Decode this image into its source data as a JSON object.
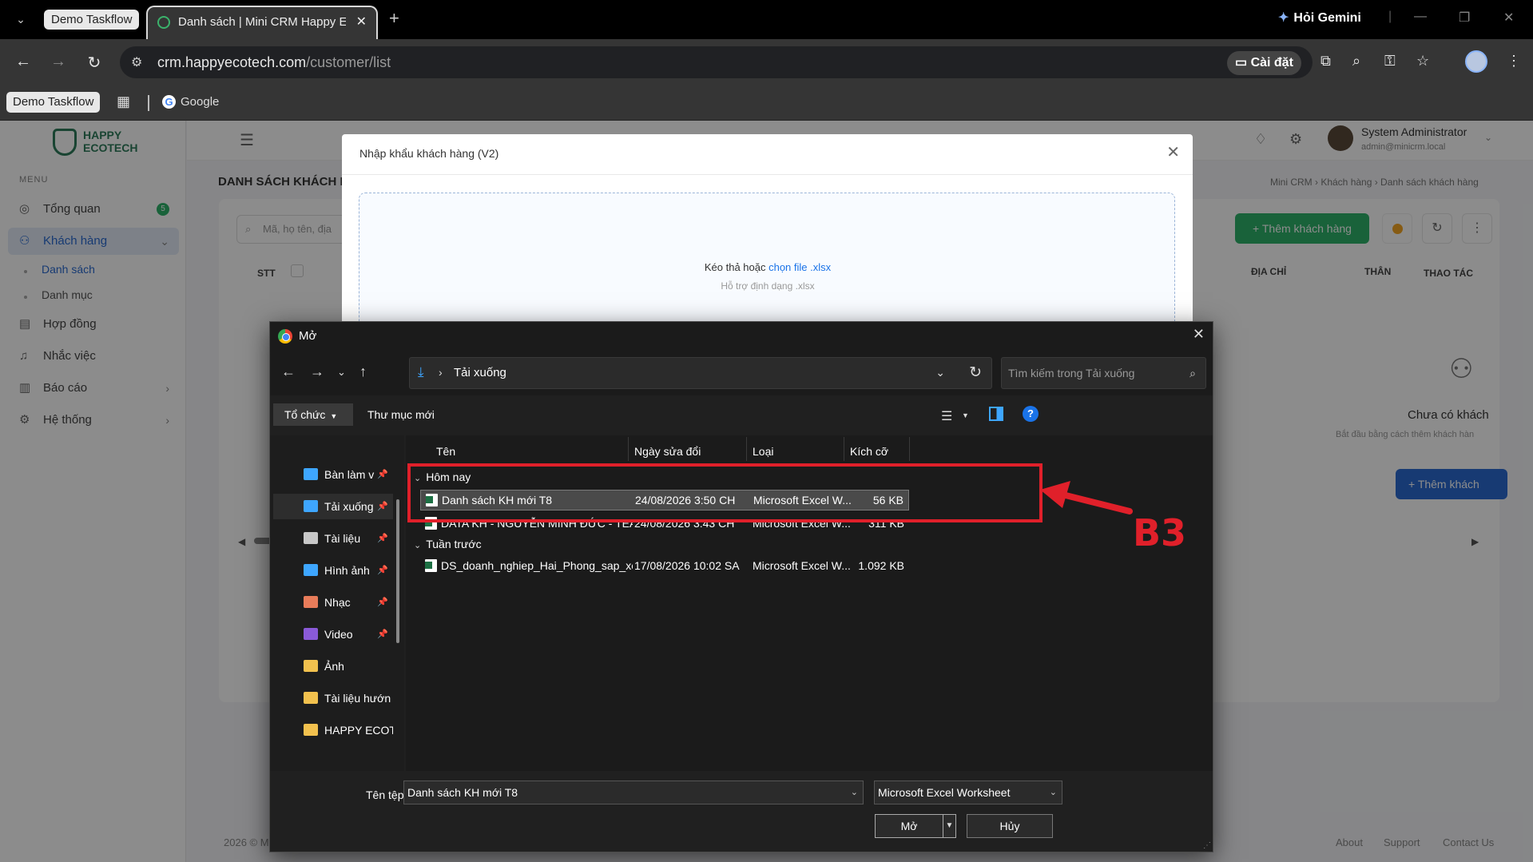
{
  "browser": {
    "tab_group_label": "Demo Taskflow",
    "active_tab_title": "Danh sách | Mini CRM Happy E",
    "gemini_label": "Hỏi Gemini",
    "url_host": "crm.happyecotech.com",
    "url_path": "/customer/list",
    "install_label": "Cài đặt",
    "bookmarks": {
      "group_label": "Demo Taskflow",
      "google_label": "Google"
    }
  },
  "app": {
    "logo_line1": "HAPPY",
    "logo_line2": "ECOTECH",
    "menu_caption": "MENU",
    "sidebar": {
      "items": [
        {
          "label": "Tổng quan",
          "badge": "5"
        },
        {
          "label": "Khách hàng"
        },
        {
          "label": "Hợp đồng"
        },
        {
          "label": "Nhắc việc"
        },
        {
          "label": "Báo cáo"
        },
        {
          "label": "Hệ thống"
        }
      ],
      "sub_items": [
        "Danh sách",
        "Danh mục"
      ]
    },
    "user": {
      "name": "System Administrator",
      "email": "admin@minicrm.local"
    },
    "page_title": "DANH SÁCH KHÁCH H",
    "breadcrumb": "Mini CRM  ›  Khách hàng  ›  Danh sách khách hàng",
    "search_placeholder": "Mã, họ tên, địa",
    "add_button": "+ Thêm khách hàng",
    "table_headers": [
      "STT",
      "ĐỊA CHỈ",
      "THÂN",
      "THAO TÁC"
    ],
    "empty_title": "Chưa có khách",
    "empty_sub": "Bắt đầu bằng cách thêm khách hàn",
    "empty_button": "+ Thêm khách",
    "footer_copy": "2026 © M",
    "footer_links": [
      "About",
      "Support",
      "Contact Us"
    ]
  },
  "import_modal": {
    "title": "Nhập khẩu khách hàng (V2)",
    "drop_text": "Kéo thả hoặc ",
    "drop_link": "chọn file .xlsx",
    "drop_sub": "Hỗ trợ định dạng .xlsx"
  },
  "file_dialog": {
    "title": "Mở",
    "location": "Tải xuống",
    "search_placeholder": "Tìm kiếm trong Tải xuống",
    "organize_label": "Tổ chức",
    "new_folder_label": "Thư mục mới",
    "nav_items": [
      {
        "label": "Bàn làm v",
        "icon": "desktop-icon",
        "color": "#3ea6ff",
        "pinned": true
      },
      {
        "label": "Tải xuống",
        "icon": "download-icon",
        "color": "#3ea6ff",
        "pinned": true
      },
      {
        "label": "Tài liệu",
        "icon": "document-icon",
        "color": "#c8c8c8",
        "pinned": true
      },
      {
        "label": "Hình ảnh",
        "icon": "pictures-icon",
        "color": "#3ea6ff",
        "pinned": true
      },
      {
        "label": "Nhạc",
        "icon": "music-icon",
        "color": "#e87c5a",
        "pinned": true
      },
      {
        "label": "Video",
        "icon": "video-icon",
        "color": "#8a5ad8",
        "pinned": true
      },
      {
        "label": "Ảnh",
        "icon": "folder-icon",
        "color": "#f2c14e",
        "pinned": false
      },
      {
        "label": "Tài liệu hướn",
        "icon": "folder-icon",
        "color": "#f2c14e",
        "pinned": false
      },
      {
        "label": "HAPPY ECOT",
        "icon": "folder-icon",
        "color": "#f2c14e",
        "pinned": false
      }
    ],
    "columns": [
      "Tên",
      "Ngày sửa đổi",
      "Loại",
      "Kích cỡ"
    ],
    "groups": [
      {
        "label": "Hôm nay",
        "files": [
          {
            "name": "Danh sách KH mới T8",
            "modified": "24/08/2026 3:50 CH",
            "type": "Microsoft Excel W...",
            "size": "56 KB",
            "selected": true
          },
          {
            "name": "DATA KH - NGUYỄN MINH ĐỨC - TEAM ...",
            "modified": "24/08/2026 3:43 CH",
            "type": "Microsoft Excel W...",
            "size": "311 KB",
            "selected": false
          }
        ]
      },
      {
        "label": "Tuần trước",
        "files": [
          {
            "name": "DS_doanh_nghiep_Hai_Phong_sap_xep_n...",
            "modified": "17/08/2026 10:02 SA",
            "type": "Microsoft Excel W...",
            "size": "1.092 KB",
            "selected": false
          }
        ]
      }
    ],
    "filename_label": "Tên tệp:",
    "filename_value": "Danh sách KH mới T8",
    "filetype_value": "Microsoft Excel Worksheet",
    "open_label": "Mở",
    "cancel_label": "Hủy"
  },
  "annotation": {
    "label": "B3",
    "color": "#e0202a"
  }
}
